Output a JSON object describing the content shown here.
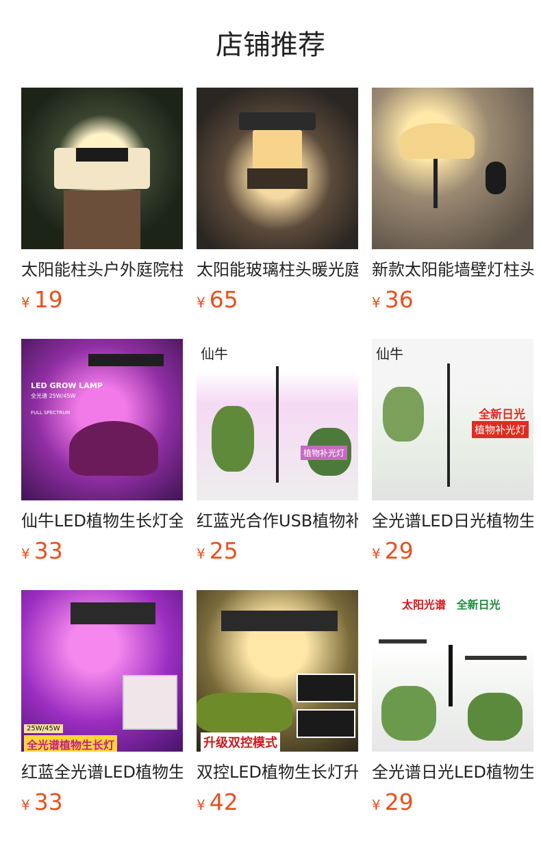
{
  "section_title": "店铺推荐",
  "products": [
    {
      "name": "太阳能柱头户外庭院柱头灯",
      "yen": "¥",
      "price": "19"
    },
    {
      "name": "太阳能玻璃柱头暖光庭院灯",
      "yen": "¥",
      "price": "65"
    },
    {
      "name": "新款太阳能墙壁灯柱头灯",
      "yen": "¥",
      "price": "36"
    },
    {
      "name": "仙牛LED植物生长灯全光谱",
      "yen": "¥",
      "price": "33"
    },
    {
      "name": "红蓝光合作USB植物补光灯",
      "yen": "¥",
      "price": "25"
    },
    {
      "name": "全光谱LED日光植物生长灯",
      "yen": "¥",
      "price": "29"
    },
    {
      "name": "红蓝全光谱LED植物生长灯",
      "yen": "¥",
      "price": "33"
    },
    {
      "name": "双控LED植物生长灯升级款",
      "yen": "¥",
      "price": "42"
    },
    {
      "name": "全光谱日光LED植物生长灯",
      "yen": "¥",
      "price": "29"
    }
  ],
  "image_texts": {
    "p4_title": "LED GROW LAMP",
    "p4_sub": "全光谱 25W/45W",
    "p4_full": "FULL SPECTRUM",
    "p5_brand": "仙牛",
    "p5_tag": "植物补光灯",
    "p6_brand": "仙牛",
    "p6_line1": "全新日光",
    "p6_line2": "植物补光灯",
    "p7_bottom": "全光谱植物生长灯",
    "p7_spec": "25W/45W",
    "p8_bottom": "升级双控模式",
    "p9_line1": "太阳光谱",
    "p9_line2": "全新日光"
  }
}
